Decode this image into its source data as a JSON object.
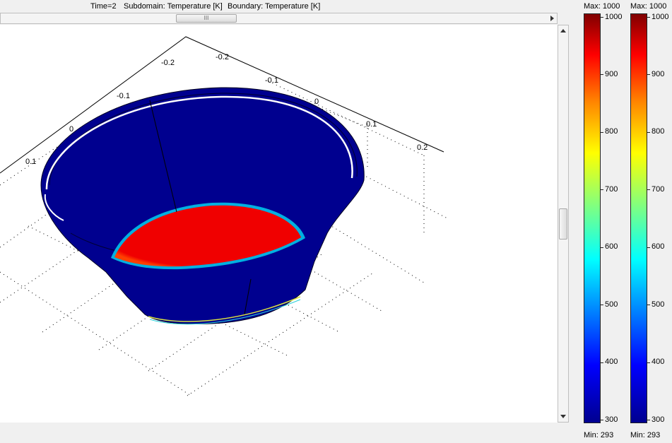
{
  "header": {
    "time": "Time=2",
    "subdomain": "Subdomain: Temperature [K]",
    "boundary": "Boundary: Temperature [K]"
  },
  "scrollbar": {
    "thumb_grip": "III"
  },
  "axes": {
    "x_ticks": [
      "-0.2",
      "-0.1",
      "0",
      "0.1",
      "0.2"
    ],
    "y_ticks": [
      "-0.2",
      "-0.1",
      "0",
      "0.1"
    ]
  },
  "legends": [
    {
      "max_label": "Max: 1000",
      "min_label": "Min: 293",
      "ticks": [
        "1000",
        "900",
        "800",
        "700",
        "600",
        "500",
        "400",
        "300"
      ]
    },
    {
      "max_label": "Max: 1000",
      "min_label": "Min: 293",
      "ticks": [
        "1000",
        "900",
        "800",
        "700",
        "600",
        "500",
        "400",
        "300"
      ]
    }
  ],
  "colors": {
    "cold": "#00008f",
    "hot": "#f00000",
    "edge_cyan": "#2ad0d8",
    "edge_yellow": "#d8e040"
  }
}
